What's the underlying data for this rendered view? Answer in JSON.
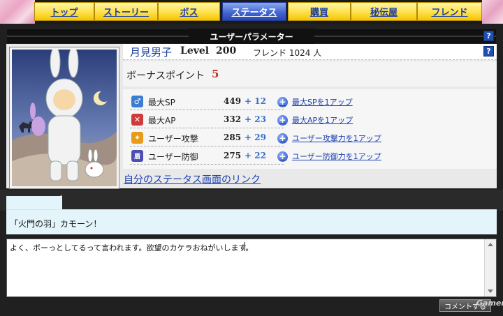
{
  "nav": {
    "tabs": [
      {
        "label": "トップ",
        "active": false
      },
      {
        "label": "ストーリー",
        "active": false
      },
      {
        "label": "ボス",
        "active": false
      },
      {
        "label": "ステータス",
        "active": true
      },
      {
        "label": "購買",
        "active": false
      },
      {
        "label": "秘伝屋",
        "active": false
      },
      {
        "label": "フレンド",
        "active": false
      }
    ]
  },
  "section": {
    "title": "ユーザーパラメーター",
    "help_label": "?"
  },
  "profile": {
    "name": "月見男子",
    "level_label": "Level",
    "level_value": "200",
    "friends": "フレンド 1024 人",
    "bonus_label": "ボーナスポイント",
    "bonus_value": "5",
    "help_label": "?",
    "avatar_icon": "bunny-costume-character"
  },
  "stats": [
    {
      "icon": "sp-icon",
      "icon_glyph": "♂",
      "icon_color": "#3a7dd1",
      "name": "最大SP",
      "value": "449",
      "bonus": "+ 12",
      "upgrade": "最大SPを1アップ"
    },
    {
      "icon": "ap-icon",
      "icon_glyph": "✕",
      "icon_color": "#d13a3a",
      "name": "最大AP",
      "value": "332",
      "bonus": "+ 23",
      "upgrade": "最大APを1アップ"
    },
    {
      "icon": "attack-icon",
      "icon_glyph": "✦",
      "icon_color": "#e89a1a",
      "name": "ユーザー攻撃",
      "value": "285",
      "bonus": "+ 29",
      "upgrade": "ユーザー攻撃力を1アップ"
    },
    {
      "icon": "defense-icon",
      "icon_glyph": "盾",
      "icon_color": "#4b4fb5",
      "name": "ユーザー防御",
      "value": "275",
      "bonus": "+ 22",
      "upgrade": "ユーザー防御力を1アップ"
    }
  ],
  "status_link": "自分のステータス画面のリンク",
  "comment": {
    "bubble_text": "「火門の羽」カモーン！",
    "textarea_value": "よく、ボーっとしてるって言われます。欲望のカケラおねがいします。",
    "submit_label": "コメントする"
  },
  "watermark": "Gamer"
}
